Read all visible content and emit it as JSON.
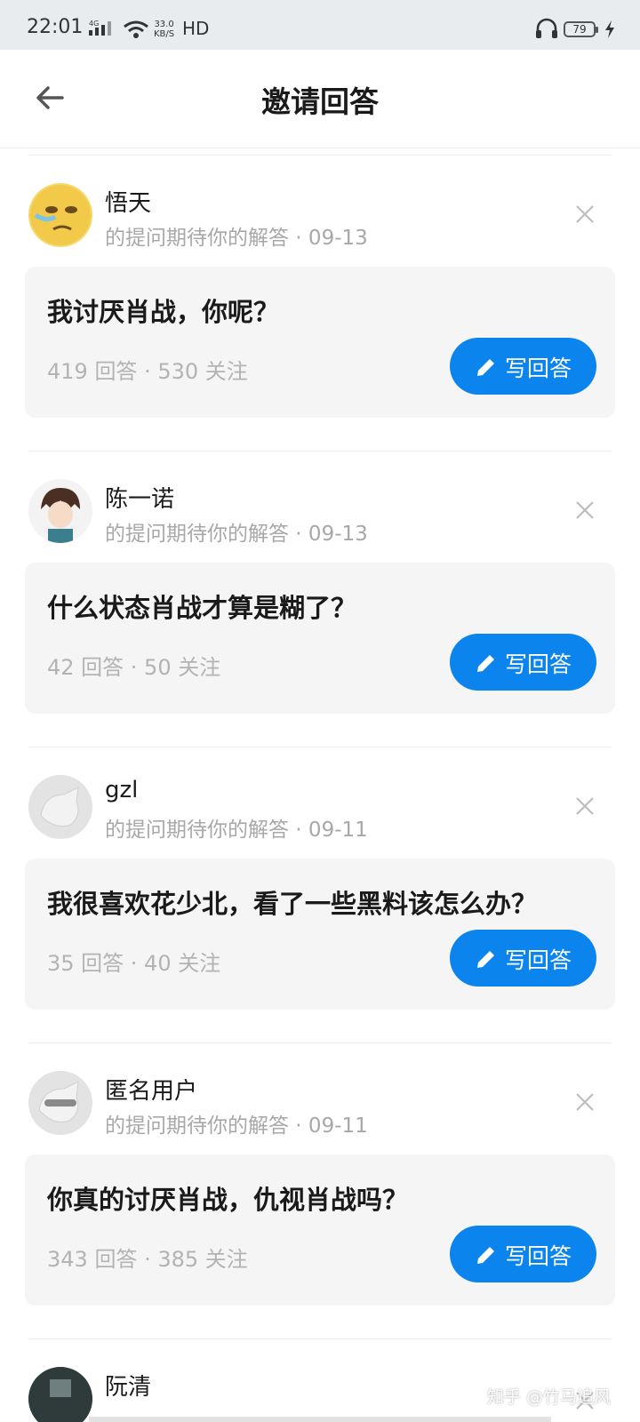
{
  "status_bar": {
    "time": "22:01",
    "network": "4G",
    "speed_value": "33.0",
    "speed_unit": "KB/S",
    "hd": "HD",
    "battery": "79"
  },
  "header": {
    "title": "邀请回答"
  },
  "invites": [
    {
      "user": "悟天",
      "meta": "的提问期待你的解答 · 09-13",
      "question": "我讨厌肖战，你呢？",
      "stats": "419 回答 · 530 关注",
      "button": "写回答"
    },
    {
      "user": "陈一诺",
      "meta": "的提问期待你的解答 · 09-13",
      "question": "什么状态肖战才算是糊了？",
      "stats": "42 回答 · 50 关注",
      "button": "写回答"
    },
    {
      "user": "gzl",
      "meta": "的提问期待你的解答 · 09-11",
      "question": "我很喜欢花少北，看了一些黑料该怎么办？",
      "stats": "35 回答 · 40 关注",
      "button": "写回答"
    },
    {
      "user": "匿名用户",
      "meta": "的提问期待你的解答 · 09-11",
      "question": "你真的讨厌肖战，仇视肖战吗？",
      "stats": "343 回答 · 385 关注",
      "button": "写回答"
    },
    {
      "user": "阮清"
    }
  ],
  "watermark": "知乎 @竹马追风",
  "colors": {
    "accent": "#0b84ee",
    "card_bg": "#f5f5f5",
    "muted_text": "#a8a8a8"
  }
}
